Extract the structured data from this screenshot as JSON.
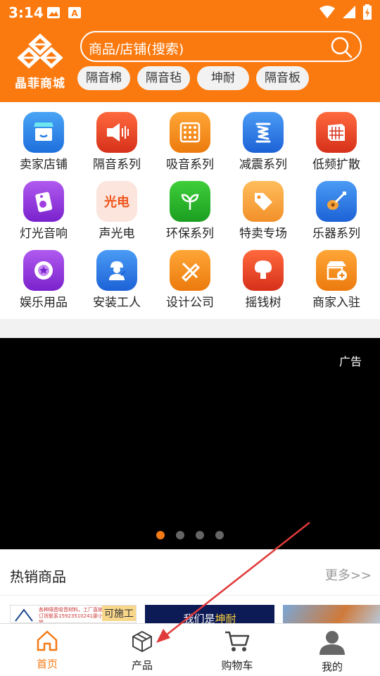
{
  "status": {
    "time": "3:14"
  },
  "brand": {
    "name": "晶菲商城",
    "color": "#fb7a10"
  },
  "search": {
    "placeholder": "商品/店铺(搜索)"
  },
  "tags": [
    "隔音棉",
    "隔音毡",
    "坤耐",
    "隔音板"
  ],
  "categories": [
    {
      "label": "卖家店铺",
      "icon": "store-icon",
      "color": "#2b7de9"
    },
    {
      "label": "隔音系列",
      "icon": "speaker-sound-icon",
      "color": "#e0401e"
    },
    {
      "label": "吸音系列",
      "icon": "acoustic-panel-icon",
      "color": "#f0800f"
    },
    {
      "label": "减震系列",
      "icon": "spring-icon",
      "color": "#2a74df"
    },
    {
      "label": "低频扩散",
      "icon": "diffuser-icon",
      "color": "#e0401e"
    },
    {
      "label": "灯光音响",
      "icon": "speaker-card-icon",
      "color": "#8a2be2"
    },
    {
      "label": "声光电",
      "icon": "light-text-icon",
      "color": "#fbe5dc"
    },
    {
      "label": "环保系列",
      "icon": "sprout-icon",
      "color": "#2aa82f"
    },
    {
      "label": "特卖专场",
      "icon": "price-tag-icon",
      "color": "#f7a23a"
    },
    {
      "label": "乐器系列",
      "icon": "guitar-icon",
      "color": "#2a74df"
    },
    {
      "label": "娱乐用品",
      "icon": "star-badge-icon",
      "color": "#8a2be2"
    },
    {
      "label": "安装工人",
      "icon": "worker-icon",
      "color": "#2a74df"
    },
    {
      "label": "设计公司",
      "icon": "design-tools-icon",
      "color": "#f0800f"
    },
    {
      "label": "摇钱树",
      "icon": "money-tree-icon",
      "color": "#e0401e"
    },
    {
      "label": "商家入驻",
      "icon": "shop-add-icon",
      "color": "#f0800f"
    }
  ],
  "banner": {
    "ad_label": "广告",
    "page_count": 4,
    "active_page": 1
  },
  "hot": {
    "title": "热销商品",
    "more": "更多>>",
    "thumb1_text": "各种隔音吸音材料，工厂直销 订货联系15923510241廖小姐",
    "thumb1_badge": "可施工",
    "thumb2_prefix": "我们是",
    "thumb2_highlight": "坤耐"
  },
  "tabs": [
    {
      "label": "首页",
      "icon": "home-icon",
      "active": true
    },
    {
      "label": "产品",
      "icon": "box-icon",
      "active": false
    },
    {
      "label": "购物车",
      "icon": "cart-icon",
      "active": false
    },
    {
      "label": "我的",
      "icon": "user-icon",
      "active": false
    }
  ],
  "colors": {
    "accent": "#f47a16",
    "annotation_arrow": "#e03a3a"
  }
}
